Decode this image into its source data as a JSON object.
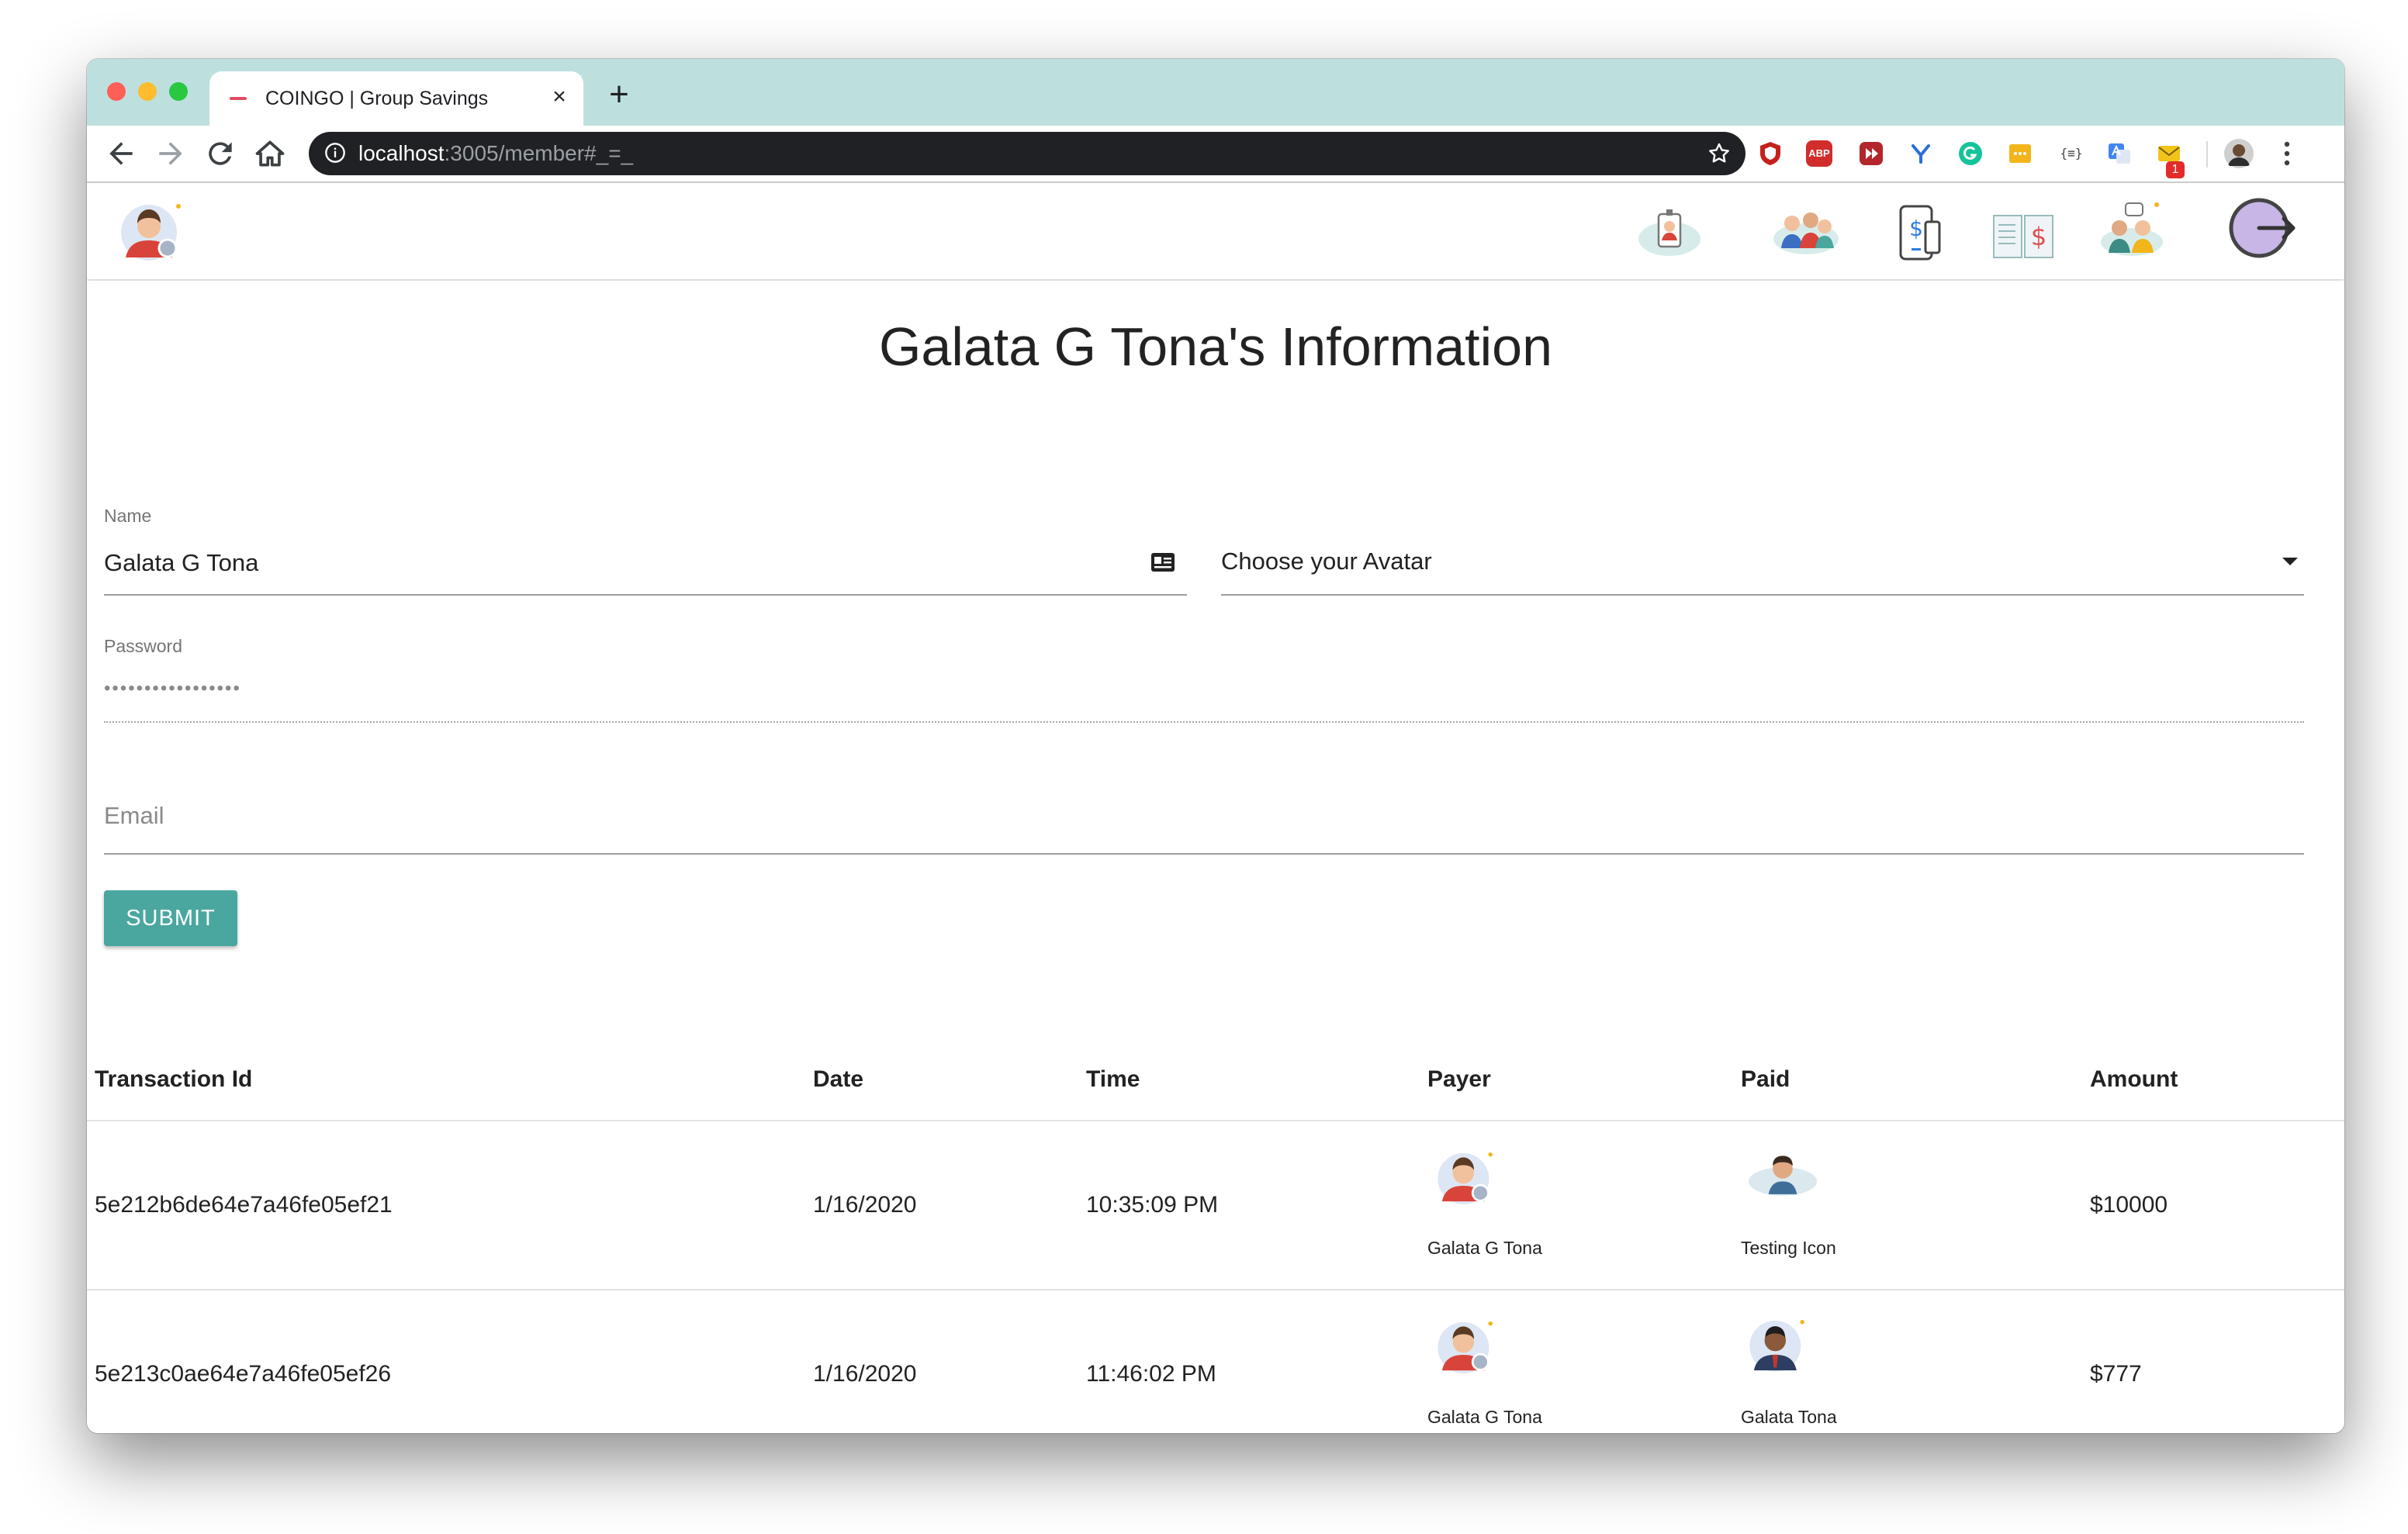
{
  "browser": {
    "tab_title": "COINGO | Group Savings",
    "tab_close": "×",
    "new_tab": "+",
    "url_host": "localhost",
    "url_rest": ":3005/member#_=_",
    "ext_badge_count": "1",
    "ext_abp_label": "ABP",
    "ext_curly_label": "{≡}"
  },
  "app": {
    "icons": [
      "profile-avatar-icon",
      "member-badge-icon",
      "group-members-icon",
      "phone-payment-icon",
      "ledger-book-icon",
      "chat-people-icon",
      "logout-icon"
    ]
  },
  "page": {
    "title": "Galata G Tona's Information"
  },
  "form": {
    "name_label": "Name",
    "name_value": "Galata G Tona",
    "avatar_placeholder": "Choose your Avatar",
    "password_label": "Password",
    "password_value": "•••••••••••••••••",
    "email_placeholder": "Email",
    "submit_label": "SUBMIT"
  },
  "table": {
    "headers": [
      "Transaction Id",
      "Date",
      "Time",
      "Payer",
      "Paid",
      "Amount"
    ],
    "rows": [
      {
        "id": "5e212b6de64e7a46fe05ef21",
        "date": "1/16/2020",
        "time": "10:35:09 PM",
        "payer": "Galata G Tona",
        "paid": "Testing Icon",
        "amount": "$10000"
      },
      {
        "id": "5e213c0ae64e7a46fe05ef26",
        "date": "1/16/2020",
        "time": "11:46:02 PM",
        "payer": "Galata G Tona",
        "paid": "Galata Tona",
        "amount": "$777"
      }
    ]
  },
  "colors": {
    "tabstrip": "#bde0df",
    "accent": "#4aa79f",
    "omnibox": "#202124"
  }
}
